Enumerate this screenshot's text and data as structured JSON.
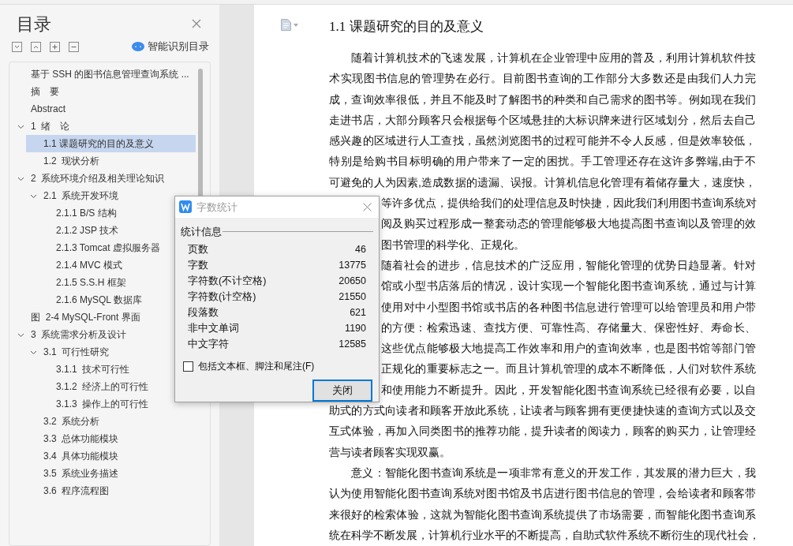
{
  "sidebar": {
    "title": "目录",
    "smart_button": "智能识别目录",
    "items": [
      {
        "label": "基于 SSH 的图书信息管理查询系统 ...",
        "selected": false
      },
      {
        "label": "摘　要",
        "selected": false
      },
      {
        "label": "Abstract",
        "selected": false
      },
      {
        "label": "1  绪　论",
        "selected": false,
        "expanded": true,
        "children": [
          {
            "label": "1.1 课题研究的目的及意义",
            "selected": true
          },
          {
            "label": "1.2  现状分析",
            "selected": false
          }
        ]
      },
      {
        "label": "2  系统环境介绍及相关理论知识",
        "selected": false,
        "expanded": true,
        "children": [
          {
            "label": "2.1  系统开发环境",
            "selected": false,
            "expanded": true,
            "children": [
              {
                "label": "2.1.1 B/S 结构",
                "selected": false
              },
              {
                "label": "2.1.2 JSP 技术",
                "selected": false
              },
              {
                "label": "2.1.3 Tomcat 虚拟服务器",
                "selected": false
              },
              {
                "label": "2.1.4 MVC 模式",
                "selected": false
              },
              {
                "label": "2.1.5 S.S.H 框架",
                "selected": false
              },
              {
                "label": "2.1.6 MySQL 数据库",
                "selected": false
              }
            ]
          }
        ]
      },
      {
        "label": "图  2-4 MySQL-Front 界面",
        "selected": false
      },
      {
        "label": "3  系统需求分析及设计",
        "selected": false,
        "expanded": true,
        "children": [
          {
            "label": "3.1  可行性研究",
            "selected": false,
            "expanded": true,
            "children": [
              {
                "label": "3.1.1  技术可行性",
                "selected": false
              },
              {
                "label": "3.1.2  经济上的可行性",
                "selected": false
              },
              {
                "label": "3.1.3  操作上的可行性",
                "selected": false
              }
            ]
          },
          {
            "label": "3.2  系统分析",
            "selected": false
          },
          {
            "label": "3.3  总体功能模块",
            "selected": false
          },
          {
            "label": "3.4  具体功能模块",
            "selected": false
          },
          {
            "label": "3.5  系统业务描述",
            "selected": false
          },
          {
            "label": "3.6  程序流程图",
            "selected": false
          }
        ]
      }
    ]
  },
  "document": {
    "heading": "1.1 课题研究的目的及意义",
    "lines": [
      {
        "kind": "first",
        "text": "随着计算机技术的飞速发展，计算机在企业管理中应用的普及，利用计算机软件技"
      },
      {
        "kind": "line",
        "text": "术实现图书信息的管理势在必行。目前图书查询的工作部分大多数还是由我们人力完"
      },
      {
        "kind": "line",
        "text": "成，查询效率很低，并且不能及时了解图书的种类和自己需求的图书等。例如现在我们"
      },
      {
        "kind": "line",
        "text": "走进书店，大部分顾客只会根据每个区域悬挂的大标识牌来进行区域划分，然后去自己"
      },
      {
        "kind": "line",
        "text": "感兴趣的区域进行人工查找，虽然浏览图书的过程可能并不令人反感，但是效率较低，"
      },
      {
        "kind": "line",
        "text": "特别是给购书目标明确的用户带来了一定的困扰。手工管理还存在这许多弊端,由于不"
      },
      {
        "kind": "line",
        "text": "可避免的人为因素,造成数据的遗漏、误报。计算机信息化管理有着储存量大，速度快，"
      },
      {
        "kind": "partial",
        "text": "等许多优点，提供给我们的处理信息及时快捷，因此我们利用图书查询系统对"
      },
      {
        "kind": "partial",
        "text": "阅及购买过程形成一整套动态的管理能够极大地提高图书查询以及管理的效"
      },
      {
        "kind": "partial_end",
        "text": "图书管理的科学化、正规化。"
      },
      {
        "kind": "partial",
        "text": "随着社会的进步，信息技术的广泛应用，智能化管理的优势日趋显著。针对"
      },
      {
        "kind": "partial",
        "text": "馆或小型书店落后的情况，设计实现一个智能化图书查询系统，通过与计算"
      },
      {
        "kind": "partial",
        "text": "使用对中小型图书馆或书店的各种图书信息进行管理可以给管理员和用户带"
      },
      {
        "kind": "partial",
        "text": "的方便：检索迅速、查找方便、可靠性高、存储量大、保密性好、寿命长、"
      },
      {
        "kind": "partial",
        "text": "这些优点能够极大地提高工作效率和用户的查询效率，也是图书馆等部门管"
      },
      {
        "kind": "partial",
        "text": "正规化的重要标志之一。而且计算机管理的成本不断降低，人们对软件系统"
      },
      {
        "kind": "partial",
        "text": "和使用能力不断提升。因此，开发智能化图书查询系统已经很有必要，以自"
      },
      {
        "kind": "line",
        "text": "助式的方式向读者和顾客开放此系统，让读者与顾客拥有更便捷快速的查询方式以及交"
      },
      {
        "kind": "line",
        "text": "互式体验，再加入同类图书的推荐功能，提升读者的阅读力，顾客的购买力，让管理经"
      },
      {
        "kind": "last",
        "text": "营与读者顾客实现双赢。"
      },
      {
        "kind": "first",
        "text": "意义：智能化图书查询系统是一项非常有意义的开发工作，其发展的潜力巨大，我"
      },
      {
        "kind": "line",
        "text": "认为使用智能化图书查询系统对图书馆及书店进行图书信息的管理，会给读者和顾客带"
      },
      {
        "kind": "line",
        "text": "来很好的检索体验，这就为智能化图书查询系统提供了市场需要，而智能化图书查询系"
      },
      {
        "kind": "line",
        "text": "统在科学不断发展，计算机行业水平的不断提高，自助式软件系统不断衍生的现代社会，"
      }
    ]
  },
  "dialog": {
    "title": "字数统计",
    "group": "统计信息",
    "stats": [
      {
        "label": "页数",
        "value": "46"
      },
      {
        "label": "字数",
        "value": "13775"
      },
      {
        "label": "字符数(不计空格)",
        "value": "20650"
      },
      {
        "label": "字符数(计空格)",
        "value": "21550"
      },
      {
        "label": "段落数",
        "value": "621"
      },
      {
        "label": "非中文单词",
        "value": "1190"
      },
      {
        "label": "中文字符",
        "value": "12585"
      }
    ],
    "checkbox": {
      "label": "包括文本框、脚注和尾注(F)",
      "checked": false
    },
    "button": "关闭"
  }
}
